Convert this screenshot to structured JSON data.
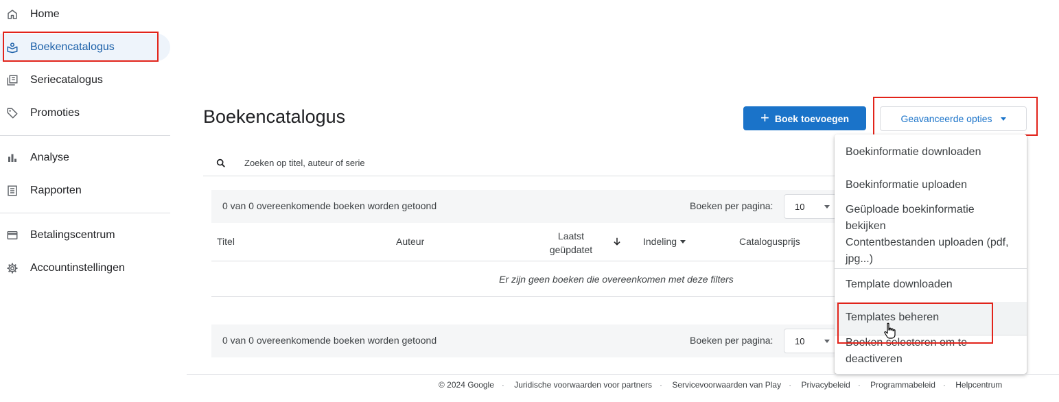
{
  "sidebar": {
    "items": [
      {
        "label": "Home",
        "icon": "home-icon"
      },
      {
        "label": "Boekencatalogus",
        "icon": "book-catalog-icon",
        "active": true
      },
      {
        "label": "Seriecatalogus",
        "icon": "series-icon"
      },
      {
        "label": "Promoties",
        "icon": "tag-icon"
      },
      {
        "label": "Analyse",
        "icon": "bar-chart-icon"
      },
      {
        "label": "Rapporten",
        "icon": "report-icon"
      },
      {
        "label": "Betalingscentrum",
        "icon": "credit-card-icon"
      },
      {
        "label": "Accountinstellingen",
        "icon": "gear-icon"
      }
    ]
  },
  "page": {
    "title": "Boekencatalogus",
    "add_book_label": "Boek toevoegen",
    "advanced_options_label": "Geavanceerde opties"
  },
  "search": {
    "placeholder": "Zoeken op titel, auteur of serie"
  },
  "results": {
    "count_text": "0 van 0 overeenkomende boeken worden getoond",
    "per_page_label": "Boeken per pagina:",
    "per_page_value": "10",
    "empty_message": "Er zijn geen boeken die overeenkomen met deze filters"
  },
  "table": {
    "columns": {
      "title": "Titel",
      "author": "Auteur",
      "updated_line1": "Laatst",
      "updated_line2": "geüpdatet",
      "format": "Indeling",
      "price": "Catalogusprijs"
    }
  },
  "menu": {
    "items": [
      "Boekinformatie downloaden",
      "Boekinformatie uploaden",
      "Geüploade boekinformatie bekijken",
      "Contentbestanden uploaden (pdf, jpg...)",
      "Template downloaden",
      "Templates beheren",
      "Boeken selecteren om te deactiveren"
    ]
  },
  "footer": {
    "items": [
      "© 2024 Google",
      "Juridische voorwaarden voor partners",
      "Servicevoorwaarden van Play",
      "Privacybeleid",
      "Programmabeleid",
      "Helpcentrum"
    ]
  },
  "colors": {
    "accent": "#1a73c9",
    "highlight": "#e2231a",
    "active_bg": "#eef4fb"
  }
}
